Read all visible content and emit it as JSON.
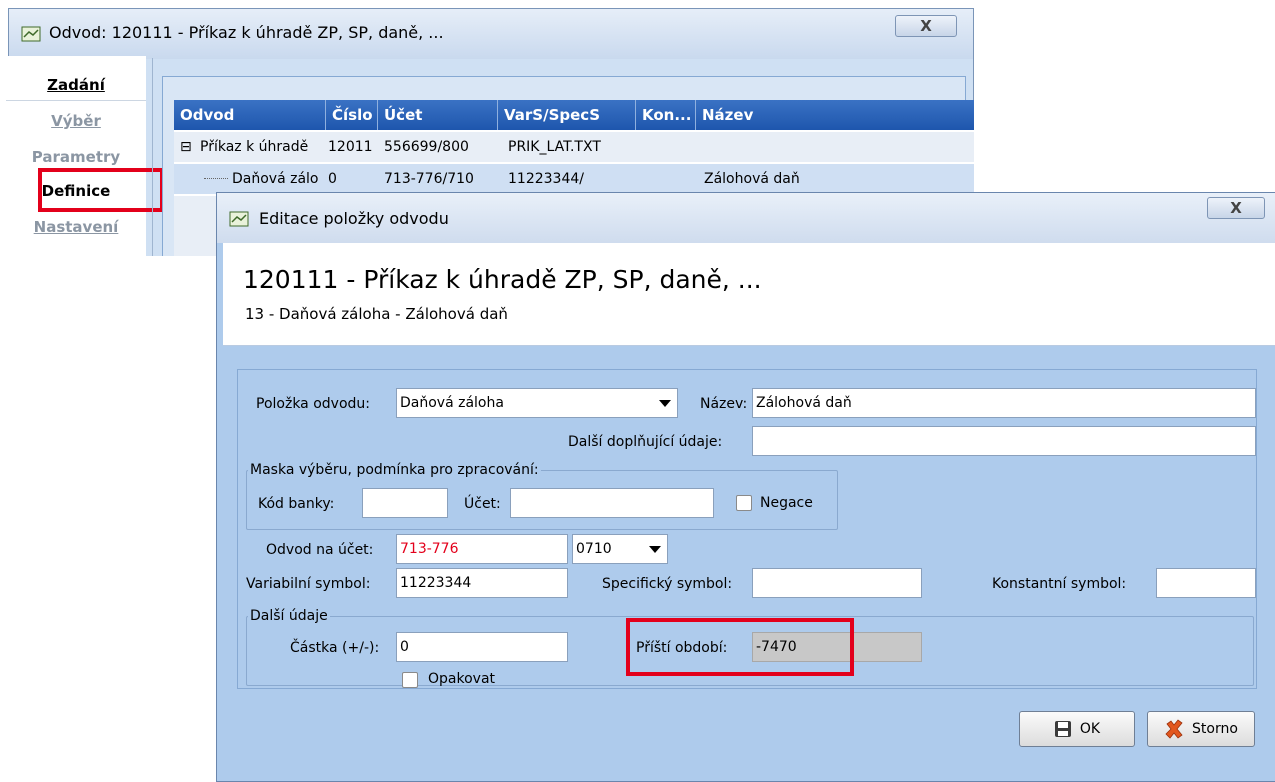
{
  "window_back": {
    "title": "Odvod: 120111 - Příkaz k úhradě ZP, SP, daně, ...",
    "close": "X",
    "nav": [
      {
        "label": "Zadání"
      },
      {
        "label": "Výběr"
      },
      {
        "label": "Parametry"
      },
      {
        "label": "Definice"
      },
      {
        "label": "Nastavení"
      }
    ],
    "grid": {
      "columns": [
        "Odvod",
        "Číslo",
        "Účet",
        "VarS/SpecS",
        "Kon...",
        "Název"
      ],
      "rows": [
        {
          "expander": "⊟",
          "odvod": "Příkaz k úhradě",
          "cislo": "12011",
          "ucet": "556699/800",
          "vars": "PRIK_LAT.TXT",
          "kon": "",
          "nazev": ""
        },
        {
          "expander": "",
          "odvod": "Daňová zálo",
          "cislo": "0",
          "ucet": "713-776/710",
          "vars": "11223344/",
          "kon": "",
          "nazev": "Zálohová daň"
        }
      ]
    }
  },
  "dialog": {
    "title": "Editace položky odvodu",
    "close": "X",
    "header_main": "120111 - Příkaz k úhradě ZP, SP, daně, ...",
    "header_sub": "13 - Daňová záloha - Zálohová daň",
    "polozka_label": "Položka odvodu:",
    "polozka_value": "Daňová záloha",
    "nazev_label": "Název:",
    "nazev_value": "Zálohová daň",
    "dalsi_doplnujici_label": "Další doplňující údaje:",
    "dalsi_doplnujici_value": "",
    "maska_title": "Maska výběru, podmínka pro zpracování:",
    "kod_banky_label": "Kód banky:",
    "kod_banky_value": "",
    "ucet_label": "Účet:",
    "ucet_value": "",
    "negace_label": "Negace",
    "odvod_na_ucet_label": "Odvod na účet:",
    "odvod_na_ucet_value": "713-776",
    "bank_code_value": "0710",
    "variabilni_label": "Variabilní symbol:",
    "variabilni_value": "11223344",
    "specificky_label": "Specifický symbol:",
    "specificky_value": "",
    "konstantni_label": "Konstantní symbol:",
    "konstantni_value": "",
    "dalsi_udaje_title": "Další údaje",
    "castka_label": "Částka (+/-):",
    "castka_value": "0",
    "opakovat_label": "Opakovat",
    "pristi_obdobi_label": "Příští období:",
    "pristi_obdobi_value": "-7470",
    "ok_label": "OK",
    "storno_label": "Storno"
  },
  "colors": {
    "highlight": "#e3001b",
    "grid_header": "#1e56ad",
    "dialog_bg": "#aecbec"
  }
}
